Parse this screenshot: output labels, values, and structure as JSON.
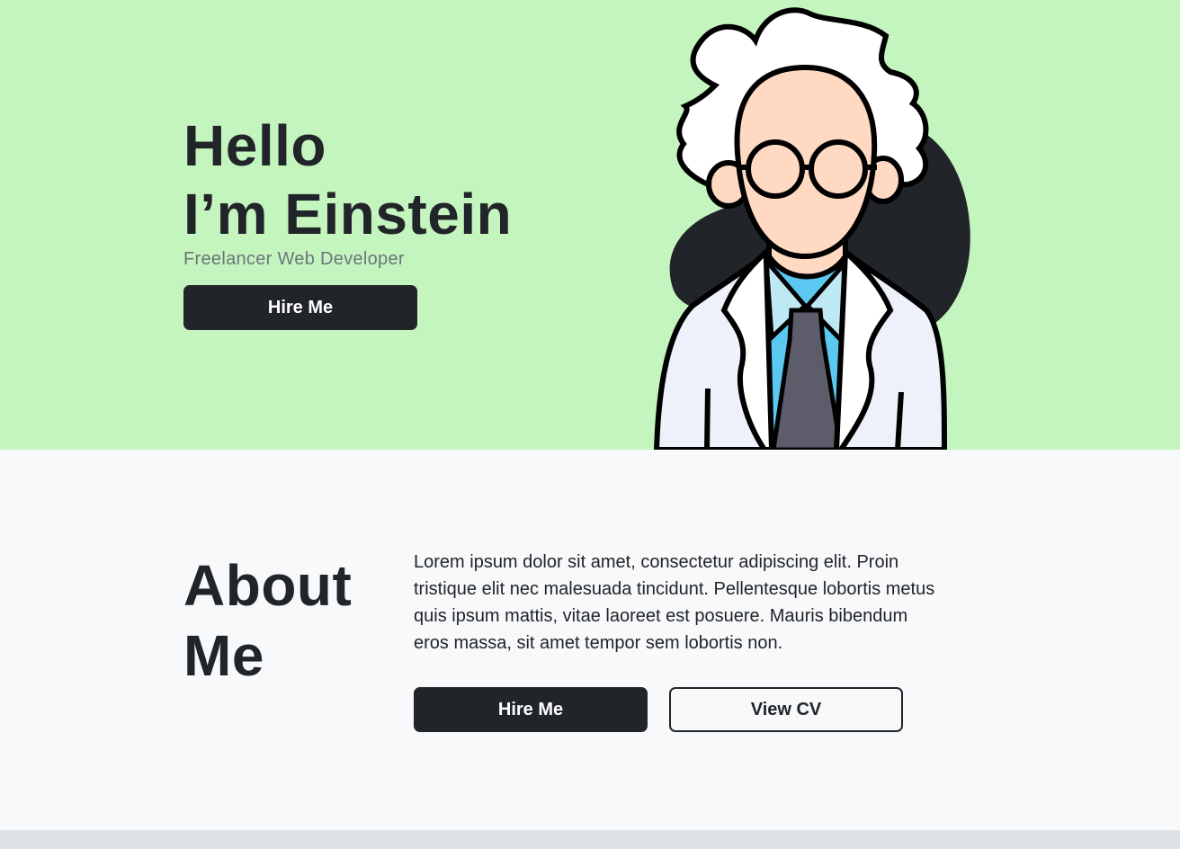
{
  "hero": {
    "title_line1": "Hello",
    "title_line2": "I’m Einstein",
    "subtitle": "Freelancer Web Developer",
    "hire_button": "Hire Me",
    "background_color": "#c5f5be",
    "illustration": "einstein-character-illustration"
  },
  "about": {
    "title_line1": "About",
    "title_line2": "Me",
    "paragraph": "Lorem ipsum dolor sit amet, consectetur adipiscing elit. Proin tristique elit nec malesuada tincidunt. Pellentesque lobortis metus quis ipsum mattis, vitae laoreet est posuere. Mauris bibendum eros massa, sit amet tempor sem lobortis non.",
    "hire_button": "Hire Me",
    "cv_button": "View CV"
  },
  "colors": {
    "dark": "#212529",
    "muted": "#6c757d",
    "light": "#f8f9fa"
  }
}
